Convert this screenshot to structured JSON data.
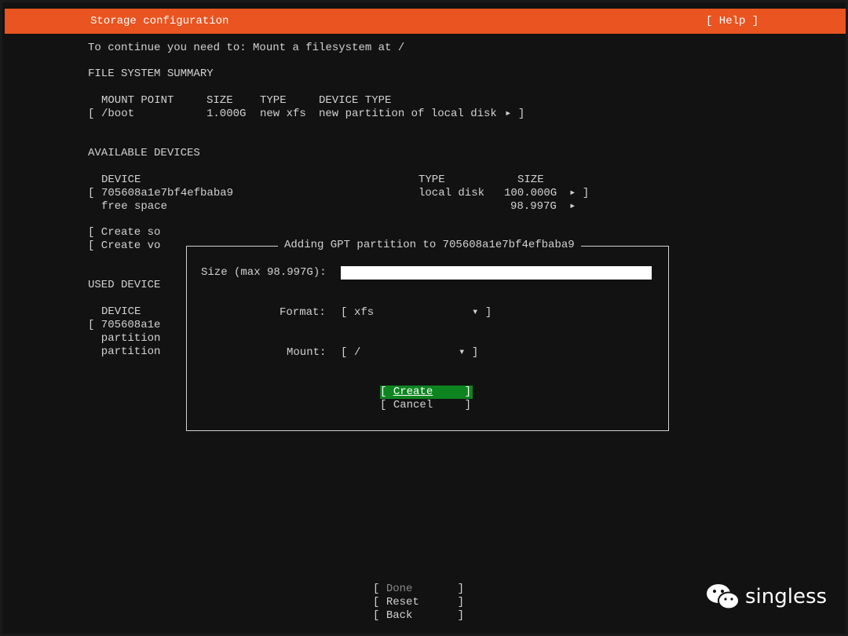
{
  "header": {
    "title": "Storage configuration",
    "help": "[ Help ]"
  },
  "instruction": "To continue you need to: Mount a filesystem at /",
  "fs_summary": {
    "heading": "FILE SYSTEM SUMMARY",
    "columns": [
      "MOUNT POINT",
      "SIZE",
      "TYPE",
      "DEVICE TYPE"
    ],
    "rows": [
      {
        "mount": "/boot",
        "size": "1.000G",
        "type": "new xfs",
        "device_type": "new partition of local disk"
      }
    ]
  },
  "available": {
    "heading": "AVAILABLE DEVICES",
    "columns": [
      "DEVICE",
      "TYPE",
      "SIZE"
    ],
    "device": {
      "name": "705608a1e7bf4efbaba9",
      "type": "local disk",
      "size": "100.000G"
    },
    "free": {
      "name": "free space",
      "size": "98.997G"
    },
    "actions": [
      "[ Create so",
      "[ Create vo"
    ]
  },
  "used": {
    "heading": "USED DEVICE",
    "column": "DEVICE",
    "rows": [
      "[ 705608a1e",
      "  partition",
      "  partition"
    ]
  },
  "dialog": {
    "title": "Adding GPT partition to 705608a1e7bf4efbaba9",
    "size_label": "Size (max 98.997G):",
    "size_value": "",
    "format_label": "Format:",
    "format_value": "xfs",
    "mount_label": "Mount:",
    "mount_value": "/",
    "create": "Create",
    "cancel": "Cancel"
  },
  "footer": {
    "done": "Done",
    "reset": "Reset",
    "back": "Back"
  },
  "watermark": "singless"
}
